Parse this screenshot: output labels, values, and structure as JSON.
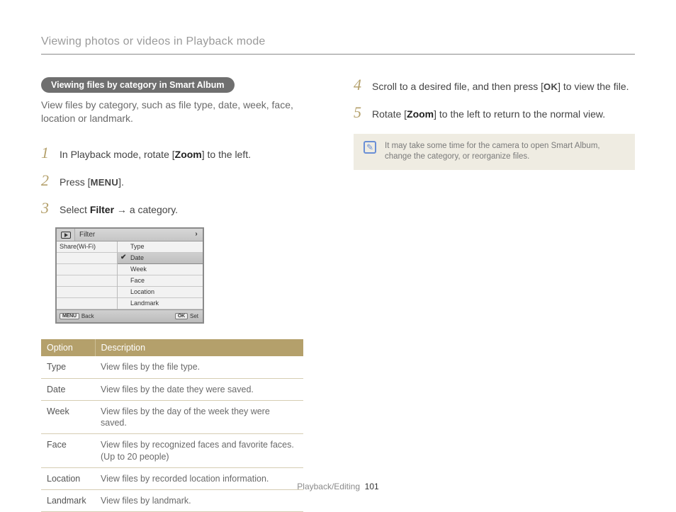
{
  "page_title": "Viewing photos or videos in Playback mode",
  "pill_label": "Viewing files by category in Smart Album",
  "intro": "View files by category, such as file type, date, week, face, location or landmark.",
  "steps_left": {
    "s1": {
      "num": "1",
      "prefix": "In Playback mode, rotate [",
      "bold": "Zoom",
      "suffix": "] to the left."
    },
    "s2": {
      "num": "2",
      "prefix": "Press [",
      "strong": "MENU",
      "suffix": "]."
    },
    "s3": {
      "num": "3",
      "prefix": "Select ",
      "bold": "Filter",
      "arrow": " → ",
      "suffix": "a category."
    }
  },
  "steps_right": {
    "s4": {
      "num": "4",
      "prefix": "Scroll to a desired file, and then press [",
      "strong": "OK",
      "suffix": "] to view the file."
    },
    "s5": {
      "num": "5",
      "prefix": "Rotate [",
      "bold": "Zoom",
      "suffix": "] to the left to return to the normal view."
    }
  },
  "lcd": {
    "filter_label": "Filter",
    "left_row": "Share(Wi-Fi)",
    "right": [
      "Type",
      "Date",
      "Week",
      "Face",
      "Location",
      "Landmark"
    ],
    "selected_index": 1,
    "foot_back_btn": "MENU",
    "foot_back": "Back",
    "foot_set_btn": "OK",
    "foot_set": "Set"
  },
  "table": {
    "head_option": "Option",
    "head_desc": "Description",
    "rows": [
      {
        "opt": "Type",
        "desc": "View files by the file type."
      },
      {
        "opt": "Date",
        "desc": "View files by the date they were saved."
      },
      {
        "opt": "Week",
        "desc": "View files by the day of the week they were saved."
      },
      {
        "opt": "Face",
        "desc": "View files by recognized faces and favorite faces. (Up to 20 people)"
      },
      {
        "opt": "Location",
        "desc": "View files by recorded location information."
      },
      {
        "opt": "Landmark",
        "desc": "View files by landmark."
      }
    ]
  },
  "note": "It may take some time for the camera to open Smart Album, change the category, or reorganize files.",
  "footer_section": "Playback/Editing",
  "footer_page": "101"
}
